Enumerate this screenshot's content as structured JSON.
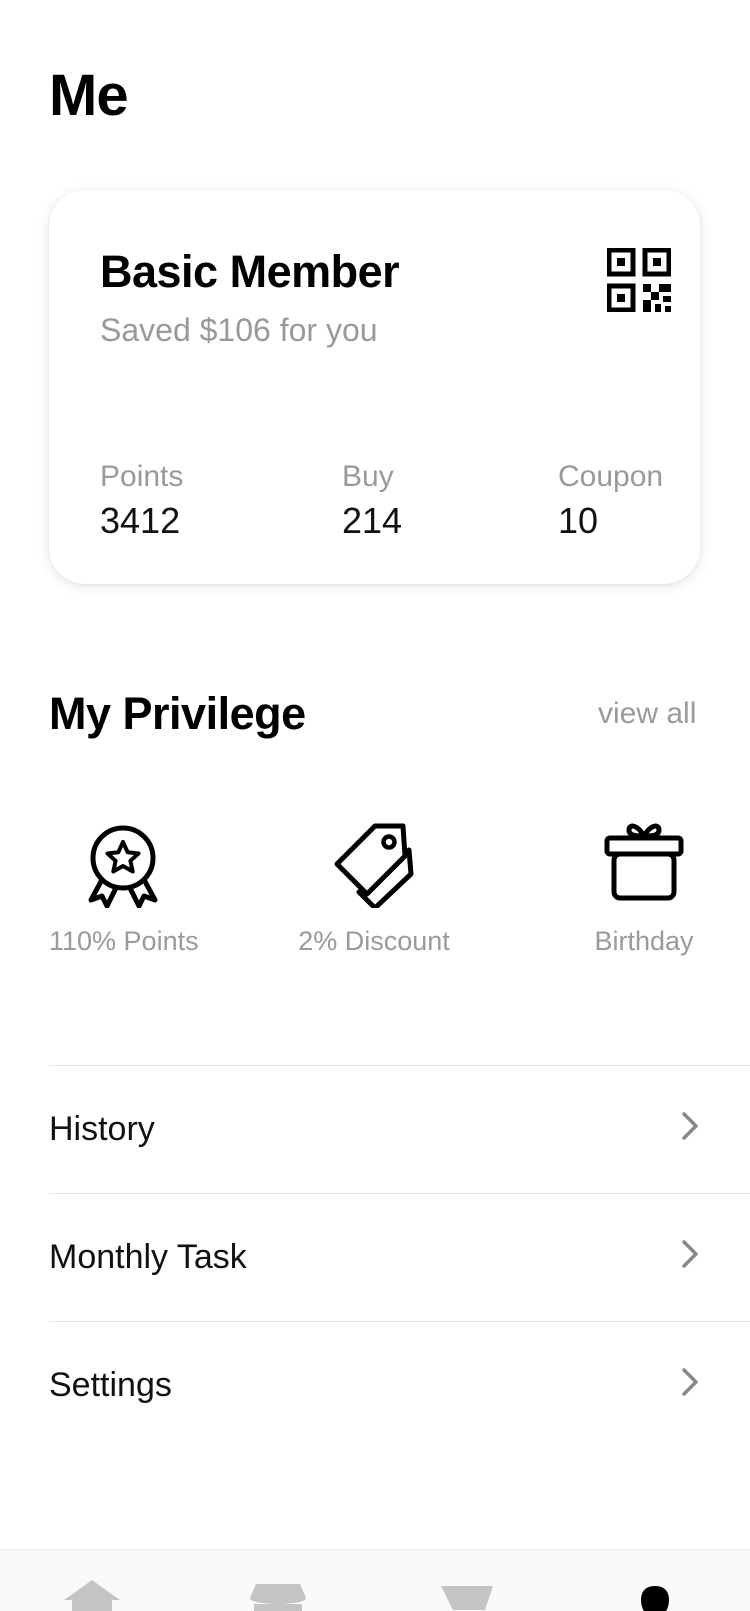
{
  "header": {
    "title": "Me"
  },
  "member_card": {
    "tier": "Basic Member",
    "savings": "Saved $106 for you",
    "qr_icon": "qr-code-icon",
    "stats": [
      {
        "label": "Points",
        "value": "3412"
      },
      {
        "label": "Buy",
        "value": "214"
      },
      {
        "label": "Coupon",
        "value": "10"
      }
    ]
  },
  "privilege": {
    "title": "My Privilege",
    "view_all": "view all",
    "items": [
      {
        "label": "110% Points",
        "icon": "award-ribbon-icon"
      },
      {
        "label": "2% Discount",
        "icon": "price-tag-icon"
      },
      {
        "label": "Birthday",
        "icon": "gift-icon"
      }
    ]
  },
  "menu": [
    {
      "label": "History"
    },
    {
      "label": "Monthly Task"
    },
    {
      "label": "Settings"
    }
  ],
  "tabbar": {
    "tabs": [
      {
        "icon": "home-icon",
        "active": false
      },
      {
        "icon": "store-icon",
        "active": false
      },
      {
        "icon": "cart-icon",
        "active": false
      },
      {
        "icon": "profile-icon",
        "active": true
      }
    ],
    "active_color": "#000000",
    "inactive_color": "#c4c4c4"
  }
}
